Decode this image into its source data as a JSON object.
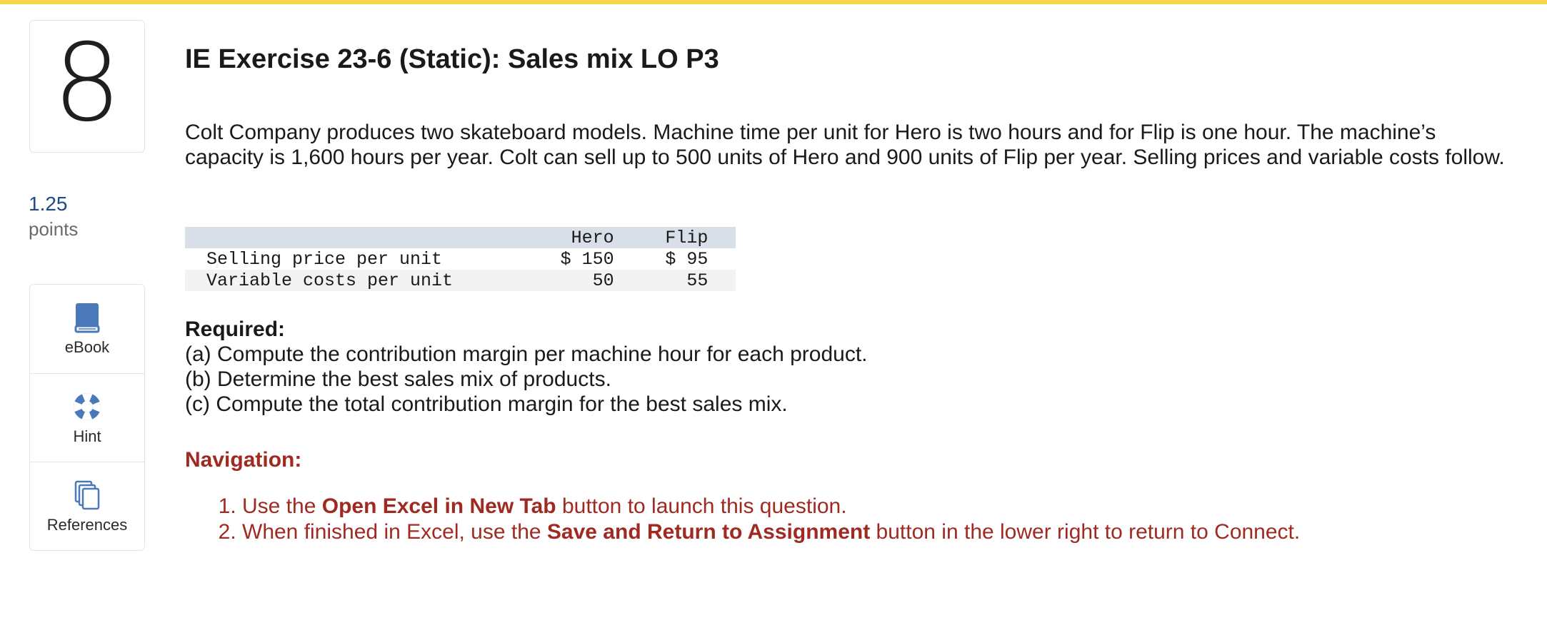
{
  "question": {
    "number": "8",
    "points_value": "1.25",
    "points_label": "points"
  },
  "tools": [
    {
      "label": "eBook",
      "icon": "book-icon"
    },
    {
      "label": "Hint",
      "icon": "lifebuoy-icon"
    },
    {
      "label": "References",
      "icon": "documents-icon"
    }
  ],
  "title": "IE Exercise 23-6 (Static): Sales mix LO P3",
  "intro": "Colt Company produces two skateboard models. Machine time per unit for Hero is two hours and for Flip is one hour. The machine’s capacity is 1,600 hours per year. Colt can sell up to 500 units of Hero and 900 units of Flip per year. Selling prices and variable costs follow.",
  "table": {
    "headers": [
      "",
      "Hero",
      "Flip"
    ],
    "rows": [
      {
        "label": "Selling price per unit",
        "hero": "$ 150",
        "flip": "$ 95"
      },
      {
        "label": "Variable costs per unit",
        "hero": "50",
        "flip": "55"
      }
    ]
  },
  "required": {
    "heading": "Required:",
    "items": [
      "(a) Compute the contribution margin per machine hour for each product.",
      "(b) Determine the best sales mix of products.",
      "(c) Compute the total contribution margin for the best sales mix."
    ]
  },
  "navigation": {
    "heading": "Navigation:",
    "steps": [
      {
        "pre": "Use the ",
        "bold": "Open Excel in New Tab",
        "post": " button to launch this question."
      },
      {
        "pre": "When finished in Excel, use the ",
        "bold": "Save and Return to Assignment",
        "post": " button in the lower right to return to Connect."
      }
    ]
  },
  "colors": {
    "accent_bar": "#f7d54a",
    "points_blue": "#1e4a8a",
    "nav_red": "#a02a22",
    "table_header_bg": "#d8dfe9",
    "icon_blue": "#4a78b8"
  }
}
